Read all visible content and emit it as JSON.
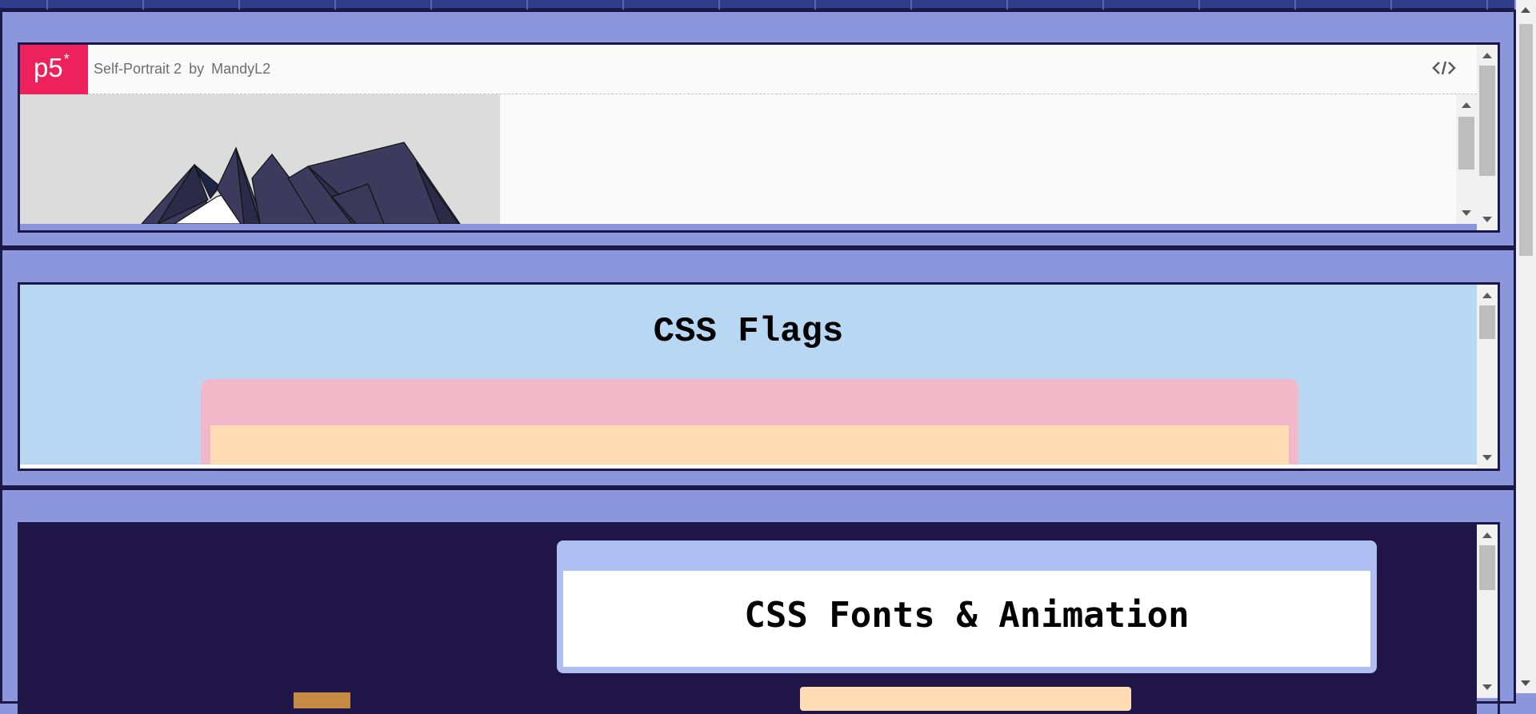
{
  "embed1": {
    "logo_text": "p5",
    "logo_sup": "*",
    "sketch_title": "Self-Portrait 2",
    "by_label": "by",
    "author": "MandyL2",
    "code_icon": "code-brackets-icon"
  },
  "embed2": {
    "heading": "CSS Flags"
  },
  "embed3": {
    "heading": "CSS Fonts & Animation"
  },
  "colors": {
    "page_background": "#8b96dc",
    "panel_border": "#1c1848",
    "p5_pink": "#ed225d",
    "flags_background": "#b7d7f2",
    "flag_pink": "#f0b8c8",
    "flag_peach": "#ffdcb4",
    "fonts_background": "#1f1547",
    "fonts_card": "#afbff4"
  }
}
